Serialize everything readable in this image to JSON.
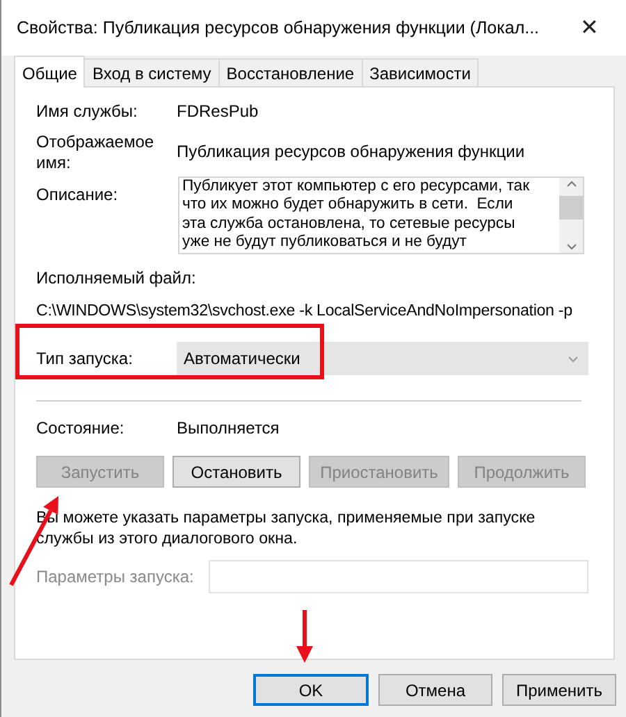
{
  "window": {
    "title": "Свойства: Публикация ресурсов обнаружения функции (Локал...",
    "close": "✕"
  },
  "tabs": [
    {
      "label": "Общие",
      "selected": true
    },
    {
      "label": "Вход в систему",
      "selected": false
    },
    {
      "label": "Восстановление",
      "selected": false
    },
    {
      "label": "Зависимости",
      "selected": false
    }
  ],
  "general": {
    "service_name": {
      "label": "Имя службы:",
      "value": "FDResPub"
    },
    "display_name": {
      "label": "Отображаемое\nимя:",
      "value": "Публикация ресурсов обнаружения функции"
    },
    "description": {
      "label": "Описание:",
      "value": "Публикует этот компьютер с его ресурсами, так\nчто их можно будет обнаружить в сети.  Если\nэта служба остановлена, то сетевые ресурсы\nуже не будут публиковаться и не будут"
    },
    "executable": {
      "label": "Исполняемый файл:",
      "value": "C:\\WINDOWS\\system32\\svchost.exe -k LocalServiceAndNoImpersonation -p"
    },
    "startup_type": {
      "label": "Тип запуска:",
      "value": "Автоматически",
      "highlighted": true
    },
    "status": {
      "label": "Состояние:",
      "value": "Выполняется"
    },
    "service_buttons": [
      {
        "label": "Запустить",
        "disabled": true,
        "pointed": true
      },
      {
        "label": "Остановить",
        "disabled": false,
        "pointed": false
      },
      {
        "label": "Приостановить",
        "disabled": true,
        "pointed": false
      },
      {
        "label": "Продолжить",
        "disabled": true,
        "pointed": false
      }
    ],
    "hint": "Вы можете указать параметры запуска, применяемые при запуске службы из этого диалогового окна.",
    "start_parameters": {
      "label": "Параметры запуска:",
      "disabled": true
    }
  },
  "dialog_buttons": [
    {
      "label": "OK",
      "default": true,
      "pointed": true
    },
    {
      "label": "Отмена",
      "default": false,
      "pointed": false
    },
    {
      "label": "Применить",
      "default": false,
      "pointed": false
    }
  ]
}
